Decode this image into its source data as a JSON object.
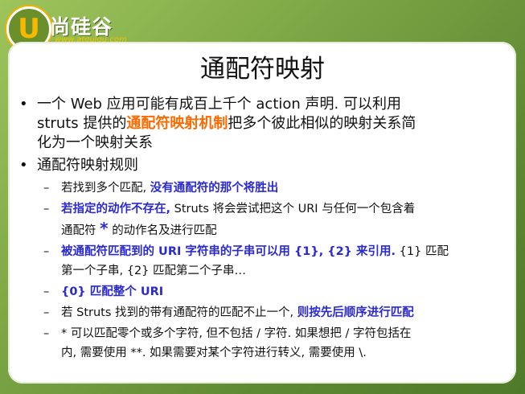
{
  "logo": {
    "letter": "U",
    "brand": "尚硅谷",
    "url": "www.atguigu.com"
  },
  "slide": {
    "title": "通配符映射",
    "bullet1": {
      "part1": "一个 Web 应用可能有成百上千个 action 声明. 可以利用",
      "part2": "struts 提供的",
      "highlight": "通配符映射机制",
      "part3": "把多个彼此相似的映射关系简",
      "part4": "化为一个映射关系"
    },
    "bullet2": "通配符映射规则",
    "rules": [
      {
        "normal": "若找到多个匹配,",
        "bold": "没有通配符的那个将胜出"
      },
      {
        "bold": "若指定的动作不存在,",
        "normal": "Struts 将会尝试把这个 URI 与任何一个包含着",
        "line2a": "通配符",
        "star": "*",
        "line2b": "的动作名及进行匹配"
      },
      {
        "bold": "被通配符匹配到的 URI 字符串的子串可以用 {1}, {2} 来引用.",
        "normal": "{1} 匹配",
        "line2": "第一个子串, {2} 匹配第二个子串…"
      },
      {
        "bold": "{0} 匹配整个 URI"
      },
      {
        "normal": "若 Struts 找到的带有通配符的匹配不止一个,",
        "bold": "则按先后顺序进行匹配"
      },
      {
        "normal": "* 可以匹配零个或多个字符, 但不包括 / 字符. 如果想把 / 字符包括在",
        "line2": "内, 需要使用 **. 如果需要对某个字符进行转义, 需要使用 \\."
      }
    ]
  }
}
